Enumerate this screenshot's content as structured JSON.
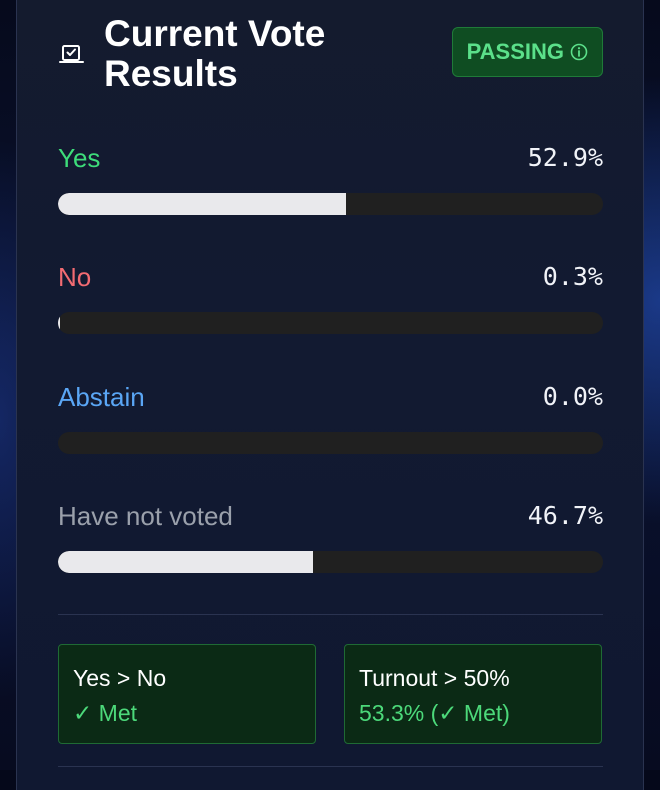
{
  "header": {
    "title": "Current Vote Results",
    "status_badge": "PASSING"
  },
  "votes": [
    {
      "label": "Yes",
      "percent_text": "52.9%",
      "fraction": 0.529,
      "color": "#3ddc7a"
    },
    {
      "label": "No",
      "percent_text": "0.3%",
      "fraction": 0.003,
      "color": "#f26b72"
    },
    {
      "label": "Abstain",
      "percent_text": "0.0%",
      "fraction": 0.0,
      "color": "#5aa6f5"
    },
    {
      "label": "Have not voted",
      "percent_text": "46.7%",
      "fraction": 0.467,
      "color": "#9aa0ab"
    }
  ],
  "criteria": [
    {
      "title": "Yes > No",
      "status": "✓ Met"
    },
    {
      "title": "Turnout > 50%",
      "status": "53.3% (✓ Met)"
    }
  ],
  "colors": {
    "passing_bg": "#0f4d22",
    "passing_text": "#5be08a",
    "bar_fill": "#e9e9ec",
    "bar_track": "#202020"
  },
  "icons": {
    "title_icon": "ballot-box-icon",
    "badge_icon": "info-icon"
  }
}
